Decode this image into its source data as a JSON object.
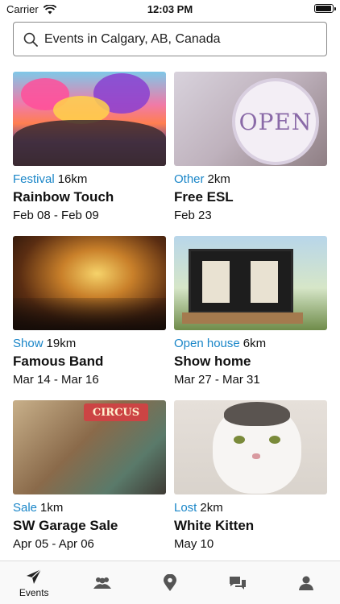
{
  "status_bar": {
    "carrier": "Carrier",
    "time": "12:03 PM",
    "battery_level": 0.95
  },
  "search": {
    "value": "Events  in Calgary, AB, Canada",
    "icon": "search-icon"
  },
  "events": [
    {
      "category": "Festival",
      "distance": "16km",
      "title": "Rainbow Touch",
      "dates": "Feb 08 - Feb 09"
    },
    {
      "category": "Other",
      "distance": "2km",
      "title": "Free ESL",
      "dates": "Feb 23",
      "sign_text": "OPEN"
    },
    {
      "category": "Show",
      "distance": "19km",
      "title": "Famous Band",
      "dates": "Mar 14 - Mar 16"
    },
    {
      "category": "Open house",
      "distance": "6km",
      "title": "Show home",
      "dates": "Mar 27 - Mar 31"
    },
    {
      "category": "Sale",
      "distance": "1km",
      "title": "SW Garage Sale",
      "dates": "Apr 05 - Apr 06",
      "sign_text": "CIRCUS"
    },
    {
      "category": "Lost",
      "distance": "2km",
      "title": "White Kitten",
      "dates": "May 10"
    }
  ],
  "tabs": [
    {
      "label": "Events",
      "icon": "paper-plane-icon",
      "active": true
    },
    {
      "label": "",
      "icon": "people-icon"
    },
    {
      "label": "",
      "icon": "map-pin-icon"
    },
    {
      "label": "",
      "icon": "chat-bubbles-icon"
    },
    {
      "label": "",
      "icon": "person-icon"
    }
  ],
  "colors": {
    "accent": "#1a86c8",
    "text": "#111111",
    "tab_icon": "#555555"
  }
}
